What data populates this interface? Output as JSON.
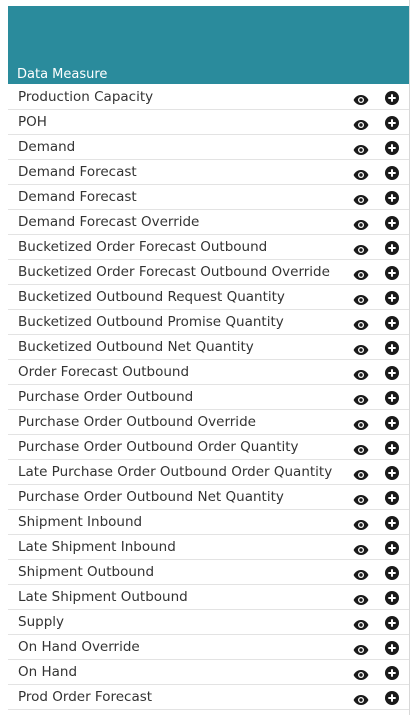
{
  "header": {
    "title": "Data Measure"
  },
  "colors": {
    "header_bg": "#2a8b9c",
    "text": "#333333",
    "icon": "#1a1a1a"
  },
  "rows": [
    {
      "label": "Production Capacity"
    },
    {
      "label": "POH"
    },
    {
      "label": "Demand"
    },
    {
      "label": "Demand Forecast"
    },
    {
      "label": "Demand Forecast"
    },
    {
      "label": "Demand Forecast Override"
    },
    {
      "label": "Bucketized Order Forecast Outbound"
    },
    {
      "label": "Bucketized Order Forecast Outbound Override"
    },
    {
      "label": "Bucketized Outbound Request Quantity"
    },
    {
      "label": "Bucketized Outbound Promise Quantity"
    },
    {
      "label": "Bucketized Outbound Net Quantity"
    },
    {
      "label": "Order Forecast Outbound"
    },
    {
      "label": "Purchase Order Outbound"
    },
    {
      "label": "Purchase Order Outbound Override"
    },
    {
      "label": "Purchase Order Outbound Order Quantity"
    },
    {
      "label": "Late Purchase Order Outbound Order Quantity"
    },
    {
      "label": "Purchase Order Outbound Net Quantity"
    },
    {
      "label": "Shipment Inbound"
    },
    {
      "label": "Late Shipment Inbound"
    },
    {
      "label": "Shipment Outbound"
    },
    {
      "label": "Late Shipment Outbound"
    },
    {
      "label": "Supply"
    },
    {
      "label": "On Hand Override"
    },
    {
      "label": "On Hand"
    },
    {
      "label": "Prod Order Forecast"
    }
  ]
}
